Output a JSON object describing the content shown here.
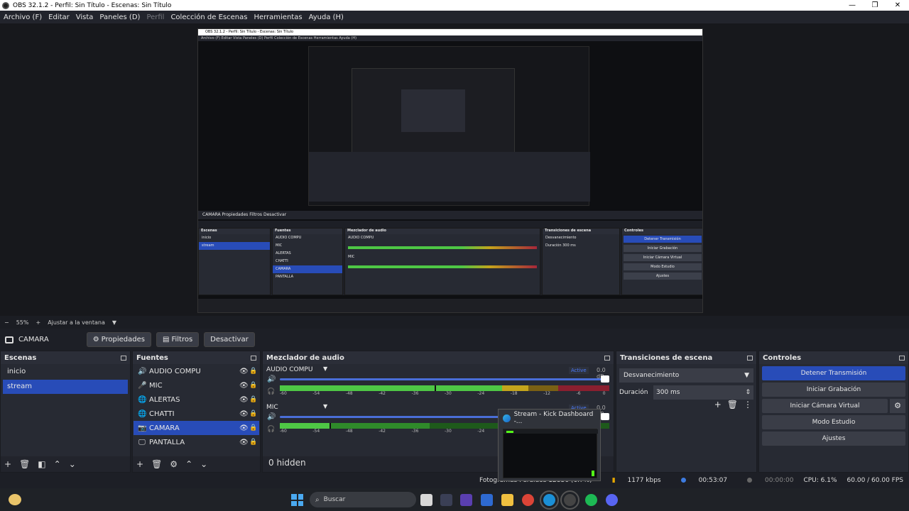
{
  "window": {
    "title": "OBS 32.1.2 - Perfil: Sin Título - Escenas: Sin Título",
    "controls": [
      "—",
      "❐",
      "✕"
    ]
  },
  "menu": [
    {
      "label": "Archivo (F)",
      "enabled": true
    },
    {
      "label": "Editar",
      "enabled": true
    },
    {
      "label": "Vista",
      "enabled": true
    },
    {
      "label": "Paneles (D)",
      "enabled": true
    },
    {
      "label": "Perfil",
      "enabled": false
    },
    {
      "label": "Colección de Escenas",
      "enabled": true
    },
    {
      "label": "Herramientas",
      "enabled": true
    },
    {
      "label": "Ayuda (H)",
      "enabled": true
    }
  ],
  "preview": {
    "zoom": "55%",
    "fit_label": "Ajustar a la ventana"
  },
  "source_toolbar": {
    "source_name": "CAMARA",
    "properties_label": "Propiedades",
    "filters_label": "Filtros",
    "deactivate_label": "Desactivar"
  },
  "scenes": {
    "title": "Escenas",
    "items": [
      {
        "label": "inicio",
        "selected": false
      },
      {
        "label": "stream",
        "selected": true
      }
    ]
  },
  "sources": {
    "title": "Fuentes",
    "items": [
      {
        "label": "AUDIO COMPU",
        "icon": "speaker-icon",
        "selected": false
      },
      {
        "label": "MIC",
        "icon": "mic-icon",
        "selected": false
      },
      {
        "label": "ALERTAS",
        "icon": "globe-icon",
        "selected": false
      },
      {
        "label": "CHATTI",
        "icon": "globe-icon",
        "selected": false
      },
      {
        "label": "CAMARA",
        "icon": "camera-icon",
        "selected": true
      },
      {
        "label": "PANTALLA",
        "icon": "monitor-icon",
        "selected": false
      }
    ]
  },
  "mixer": {
    "title": "Mezclador de audio",
    "channels": [
      {
        "name": "AUDIO COMPU",
        "status": "Active",
        "db": "0.0 dB",
        "volume": 1.0
      },
      {
        "name": "MIC",
        "status": "Active",
        "db": "0.0 dB",
        "volume": 1.0
      }
    ],
    "scale": [
      "-60",
      "-54",
      "-48",
      "-42",
      "-36",
      "-30",
      "-24",
      "-18",
      "-12",
      "-6",
      "0"
    ],
    "hidden_label": "0 hidden"
  },
  "transitions": {
    "title": "Transiciones de escena",
    "selected": "Desvanecimiento",
    "duration_label": "Duración",
    "duration_value": "300 ms"
  },
  "controls": {
    "title": "Controles",
    "stop_stream": "Detener Transmisión",
    "start_recording": "Iniciar Grabación",
    "start_virtual_cam": "Iniciar Cámara Virtual",
    "studio_mode": "Modo Estudio",
    "settings": "Ajustes"
  },
  "status": {
    "dropped_frames": "Fotogramas Perdidos 12836 (6.7%)",
    "bitrate": "1177 kbps",
    "stream_time": "00:53:07",
    "rec_time": "00:00:00",
    "cpu": "CPU: 6.1%",
    "fps": "60.00 / 60.00 FPS"
  },
  "thumbnail": {
    "title": "Stream - Kick Dashboard -..."
  },
  "taskbar": {
    "search_placeholder": "Buscar"
  }
}
